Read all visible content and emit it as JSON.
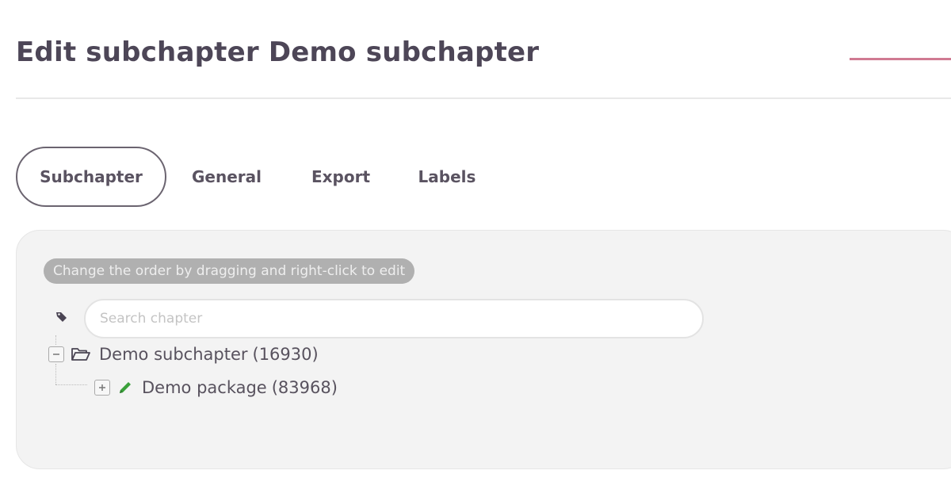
{
  "header": {
    "title": "Edit subchapter Demo subchapter"
  },
  "tabs": [
    {
      "label": "Subchapter",
      "active": true
    },
    {
      "label": "General",
      "active": false
    },
    {
      "label": "Export",
      "active": false
    },
    {
      "label": "Labels",
      "active": false
    }
  ],
  "panel": {
    "hint": "Change the order by dragging and right-click to edit",
    "search": {
      "placeholder": "Search chapter",
      "value": ""
    },
    "tree": [
      {
        "label": "Demo subchapter",
        "id": "(16930)",
        "icon": "folder-open-icon",
        "toggle": "collapse",
        "children": [
          {
            "label": "Demo package",
            "id": "(83968)",
            "icon": "pencil-icon",
            "toggle": "expand"
          }
        ]
      }
    ]
  },
  "colors": {
    "accent": "#d07a92",
    "title": "#4d4657",
    "panel_bg": "#f3f3f3",
    "pencil": "#3aa03a"
  }
}
